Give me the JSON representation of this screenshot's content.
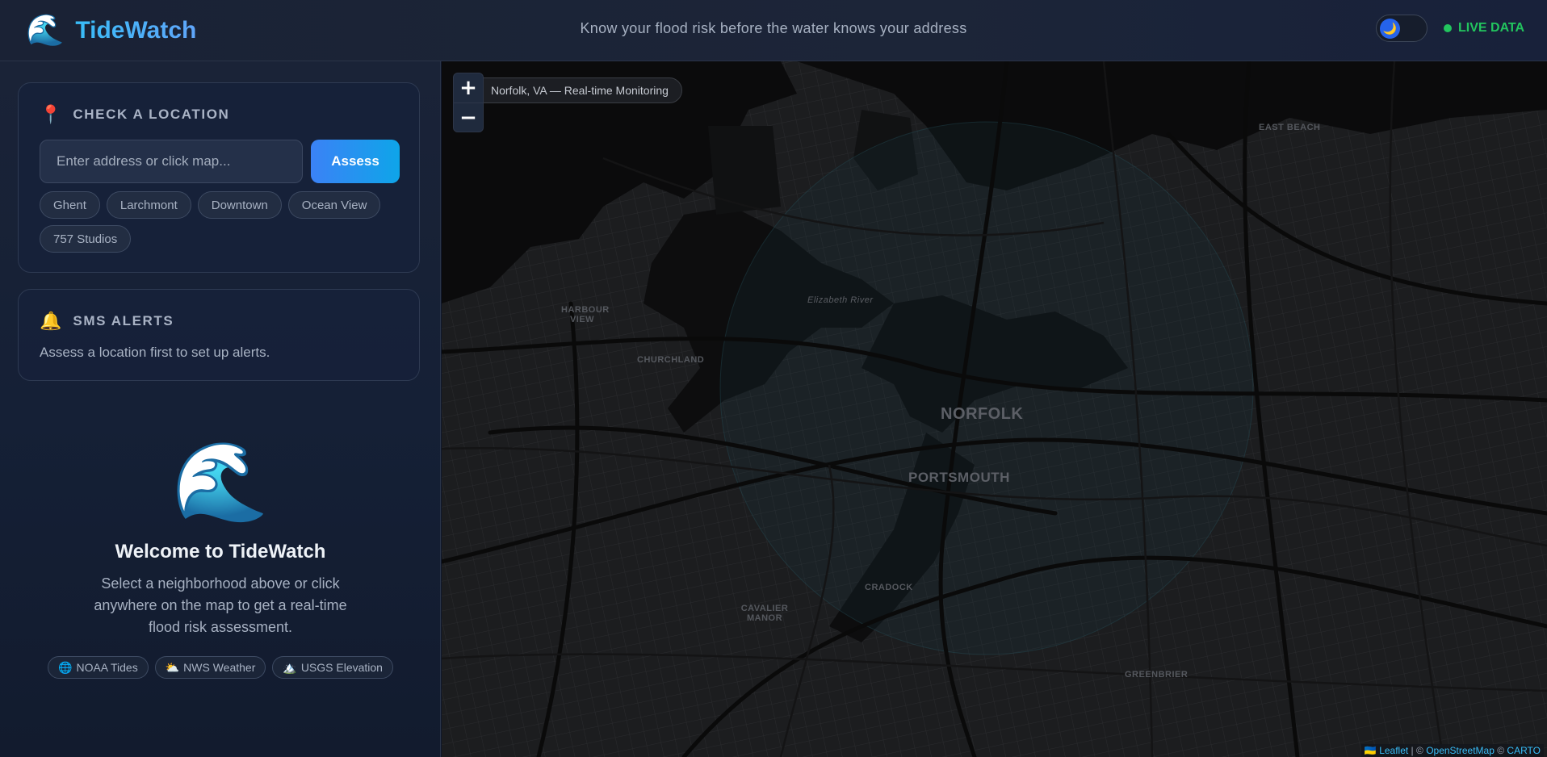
{
  "header": {
    "logo_icon": "🌊",
    "app_name": "TideWatch",
    "tagline": "Know your flood risk before the water knows your address",
    "theme_icon": "🌙",
    "live_label": "LIVE DATA"
  },
  "location_card": {
    "icon": "📍",
    "title": "CHECK A LOCATION",
    "input_placeholder": "Enter address or click map...",
    "input_value": "",
    "assess_label": "Assess",
    "neighborhoods": [
      "Ghent",
      "Larchmont",
      "Downtown",
      "Ocean View",
      "757 Studios"
    ]
  },
  "sms_card": {
    "icon": "🔔",
    "title": "SMS ALERTS",
    "message": "Assess a location first to set up alerts."
  },
  "welcome": {
    "icon": "🌊",
    "title": "Welcome to TideWatch",
    "description": "Select a neighborhood above or click anywhere on the map to get a real-time flood risk assessment.",
    "sources": [
      {
        "icon": "🌐",
        "label": "NOAA Tides"
      },
      {
        "icon": "⛅",
        "label": "NWS Weather"
      },
      {
        "icon": "🏔️",
        "label": "USGS Elevation"
      }
    ]
  },
  "map": {
    "caption": "Norfolk, VA — Real-time Monitoring",
    "zoom_in": "+",
    "zoom_out": "−",
    "places": {
      "east_beach": "EAST BEACH",
      "harbour_view": "HARBOUR VIEW",
      "elizabeth_river": "Elizabeth River",
      "churchland": "CHURCHLAND",
      "norfolk": "NORFOLK",
      "portsmouth": "PORTSMOUTH",
      "cradock": "CRADOCK",
      "cavalier_manor": "CAVALIER MANOR",
      "greenbrier": "GREENBRIER"
    },
    "attribution": {
      "flag": "🇺🇦",
      "leaflet": "Leaflet",
      "sep1": " | © ",
      "osm": "OpenStreetMap",
      "sep2": " © ",
      "carto": "CARTO"
    }
  }
}
